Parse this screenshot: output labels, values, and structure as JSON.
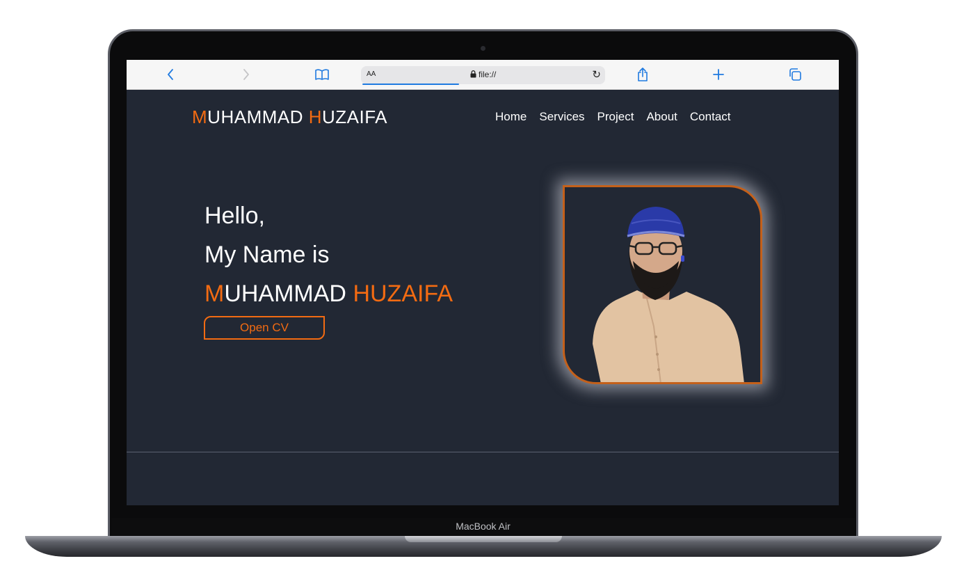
{
  "device": {
    "label": "MacBook Air"
  },
  "browser": {
    "text_size_label": "AA",
    "url": "file://",
    "icons": [
      "back-icon",
      "forward-icon",
      "bookmarks-icon",
      "reload-icon",
      "share-icon",
      "new-tab-icon",
      "tabs-icon"
    ]
  },
  "site": {
    "logo": {
      "first_initial": "M",
      "first_rest": "UHAMMAD ",
      "second_initial": "H",
      "second_rest": "UZAIFA"
    },
    "nav": {
      "items": [
        {
          "label": "Home"
        },
        {
          "label": "Services"
        },
        {
          "label": "Project"
        },
        {
          "label": "About"
        },
        {
          "label": "Contact"
        }
      ]
    },
    "hero": {
      "greeting": "Hello,",
      "intro": "My Name is",
      "name_initial": "M",
      "name_rest": "UHAMMAD ",
      "name_highlight": "HUZAIFA",
      "cv_button": "Open CV"
    },
    "colors": {
      "accent": "#f36b12",
      "background": "#222834",
      "text": "#ffffff"
    }
  }
}
